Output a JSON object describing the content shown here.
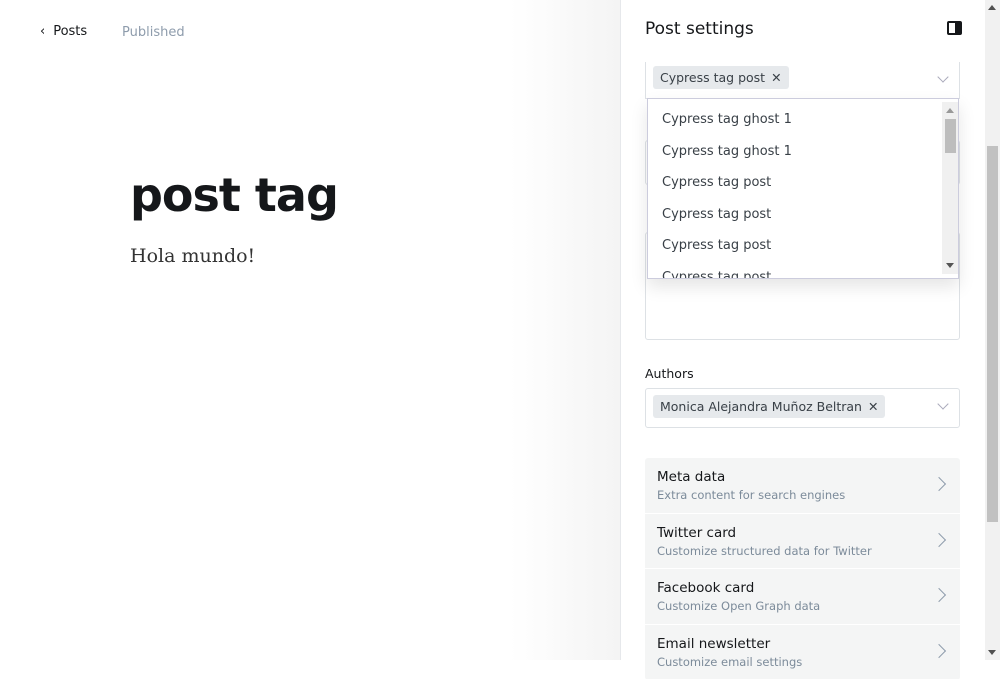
{
  "header": {
    "back_label": "Posts",
    "status": "Published"
  },
  "post": {
    "title": "post tag",
    "body": "Hola mundo!"
  },
  "settings": {
    "title": "Post settings",
    "tags": {
      "selected": [
        "Cypress tag post"
      ],
      "options": [
        "Cypress tag ghost 1",
        "Cypress tag ghost 1",
        "Cypress tag post",
        "Cypress tag post",
        "Cypress tag post",
        "Cypress tag post"
      ]
    },
    "authors": {
      "label": "Authors",
      "selected": [
        "Monica Alejandra Muñoz Beltran"
      ]
    },
    "menu": [
      {
        "title": "Meta data",
        "subtitle": "Extra content for search engines"
      },
      {
        "title": "Twitter card",
        "subtitle": "Customize structured data for Twitter"
      },
      {
        "title": "Facebook card",
        "subtitle": "Customize Open Graph data"
      },
      {
        "title": "Email newsletter",
        "subtitle": "Customize email settings"
      }
    ]
  }
}
